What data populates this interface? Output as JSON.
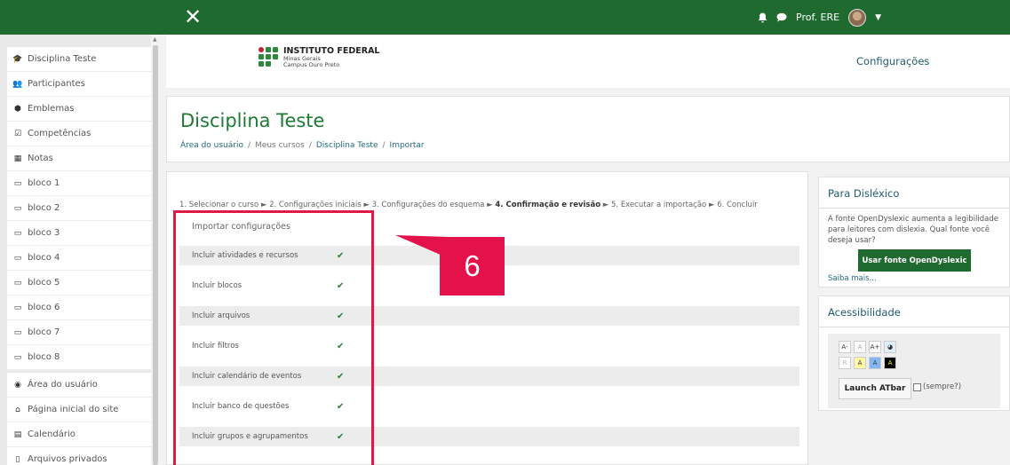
{
  "topbar": {
    "close_icon": "close-icon",
    "user_name": "Prof. ERE",
    "bell_icon": "bell-icon",
    "message_icon": "chat-bubble-icon",
    "dropdown_icon": "caret-down-icon",
    "color": "#1f6a2e"
  },
  "sidebar": {
    "items": [
      {
        "label": "Disciplina Teste",
        "icon": "graduation-cap-icon"
      },
      {
        "label": "Participantes",
        "icon": "users-icon"
      },
      {
        "label": "Emblemas",
        "icon": "shield-icon"
      },
      {
        "label": "Competências",
        "icon": "check-square-icon"
      },
      {
        "label": "Notas",
        "icon": "table-icon"
      },
      {
        "label": "bloco 1",
        "icon": "folder-icon"
      },
      {
        "label": "bloco 2",
        "icon": "folder-icon"
      },
      {
        "label": "bloco 3",
        "icon": "folder-icon"
      },
      {
        "label": "bloco 4",
        "icon": "folder-icon"
      },
      {
        "label": "bloco 5",
        "icon": "folder-icon"
      },
      {
        "label": "bloco 6",
        "icon": "folder-icon"
      },
      {
        "label": "bloco 7",
        "icon": "folder-icon"
      },
      {
        "label": "bloco 8",
        "icon": "folder-icon"
      }
    ],
    "items2": [
      {
        "label": "Área do usuário",
        "icon": "dashboard-icon"
      },
      {
        "label": "Página inicial do site",
        "icon": "home-icon"
      },
      {
        "label": "Calendário",
        "icon": "calendar-icon"
      },
      {
        "label": "Arquivos privados",
        "icon": "file-icon"
      }
    ]
  },
  "header": {
    "logo_title": "INSTITUTO FEDERAL",
    "logo_sub1": "Minas Gerais",
    "logo_sub2": "Campus Ouro Preto",
    "config_link": "Configurações"
  },
  "page": {
    "title": "Disciplina Teste",
    "breadcrumb": [
      "Área do usuário",
      "Meus cursos",
      "Disciplina Teste",
      "Importar"
    ],
    "breadcrumb_sep": "/"
  },
  "import": {
    "steps_before": "1. Selecionar o curso ► 2. Configurações iniciais ► 3. Configurações do esquema ► ",
    "step_current": "4. Confirmação e revisão",
    "steps_after": " ► 5. Executar a importação ► 6. Concluir",
    "section_title": "Importar configurações",
    "rows": [
      {
        "label": "Incluir atividades e recursos",
        "checked": true
      },
      {
        "label": "Incluir blocos",
        "checked": true
      },
      {
        "label": "Incluir arquivos",
        "checked": true
      },
      {
        "label": "Incluir filtros",
        "checked": true
      },
      {
        "label": "Incluir calendário de eventos",
        "checked": true
      },
      {
        "label": "Incluir banco de questões",
        "checked": true
      },
      {
        "label": "Incluir grupos e agrupamentos",
        "checked": true
      }
    ],
    "check_glyph": "✔"
  },
  "annotation": {
    "number": "6",
    "color": "#e4124b"
  },
  "dyslexic": {
    "title": "Para Disléxico",
    "text": "A fonte OpenDyslexic aumenta a legibilidade para leitores com dislexia. Qual fonte você deseja usar?",
    "button": "Usar fonte OpenDyslexic",
    "more": "Saiba mais..."
  },
  "accessibility": {
    "title": "Acessibilidade",
    "row1": [
      "A-",
      "A",
      "A+"
    ],
    "row2": [
      "R",
      "A",
      "A",
      "A"
    ],
    "launch": "Launch ATbar",
    "sempre": "(sempre?)"
  }
}
